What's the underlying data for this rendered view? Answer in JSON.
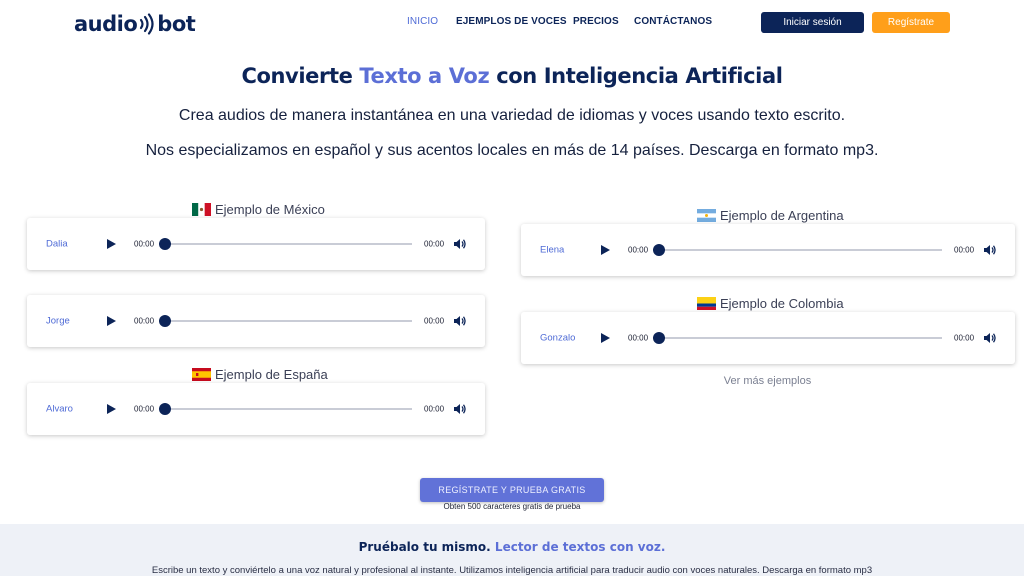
{
  "header": {
    "logo_left": "audio",
    "logo_right": "bot",
    "nav": [
      {
        "label": "INICIO",
        "active": true
      },
      {
        "label": "EJEMPLOS DE VOCES",
        "active": false
      },
      {
        "label": "PRECIOS",
        "active": false
      },
      {
        "label": "CONTÁCTANOS",
        "active": false
      }
    ],
    "login_label": "Iniciar sesión",
    "register_label": "Regístrate"
  },
  "hero": {
    "title_pre": "Convierte ",
    "title_accent": "Texto a Voz",
    "title_post": " con Inteligencia Artificial",
    "line1": "Crea audios de manera instantánea en una variedad de idiomas y voces usando texto escrito.",
    "line2": "Nos especializamos en español y sus acentos locales en más de 14 países. Descarga en formato mp3."
  },
  "examples": {
    "mexico": {
      "title": "Ejemplo de México",
      "flag": "mexico-flag",
      "voices": [
        {
          "name": "Dalia",
          "start": "00:00",
          "end": "00:00"
        },
        {
          "name": "Jorge",
          "start": "00:00",
          "end": "00:00"
        }
      ]
    },
    "espana": {
      "title": "Ejemplo de España",
      "flag": "spain-flag",
      "voices": [
        {
          "name": "Alvaro",
          "start": "00:00",
          "end": "00:00"
        }
      ]
    },
    "argentina": {
      "title": "Ejemplo de Argentina",
      "flag": "argentina-flag",
      "voices": [
        {
          "name": "Elena",
          "start": "00:00",
          "end": "00:00"
        }
      ]
    },
    "colombia": {
      "title": "Ejemplo de Colombia",
      "flag": "colombia-flag",
      "voices": [
        {
          "name": "Gonzalo",
          "start": "00:00",
          "end": "00:00"
        }
      ]
    },
    "more_label": "Ver más ejemplos"
  },
  "cta": {
    "button_label": "REGÍSTRATE Y PRUEBA GRATIS",
    "note": "Obten 500 caracteres gratis de prueba"
  },
  "footer": {
    "title_pre": "Pruébalo tu mismo. ",
    "title_accent": "Lector de textos con voz.",
    "text": "Escribe un texto y conviértelo a una voz natural y profesional al instante. Utilizamos inteligencia artificial para traducir audio con voces naturales. Descarga en formato mp3"
  },
  "colors": {
    "brand_dark": "#0c2458",
    "accent": "#5c6fd6",
    "orange": "#ff9f1a"
  }
}
